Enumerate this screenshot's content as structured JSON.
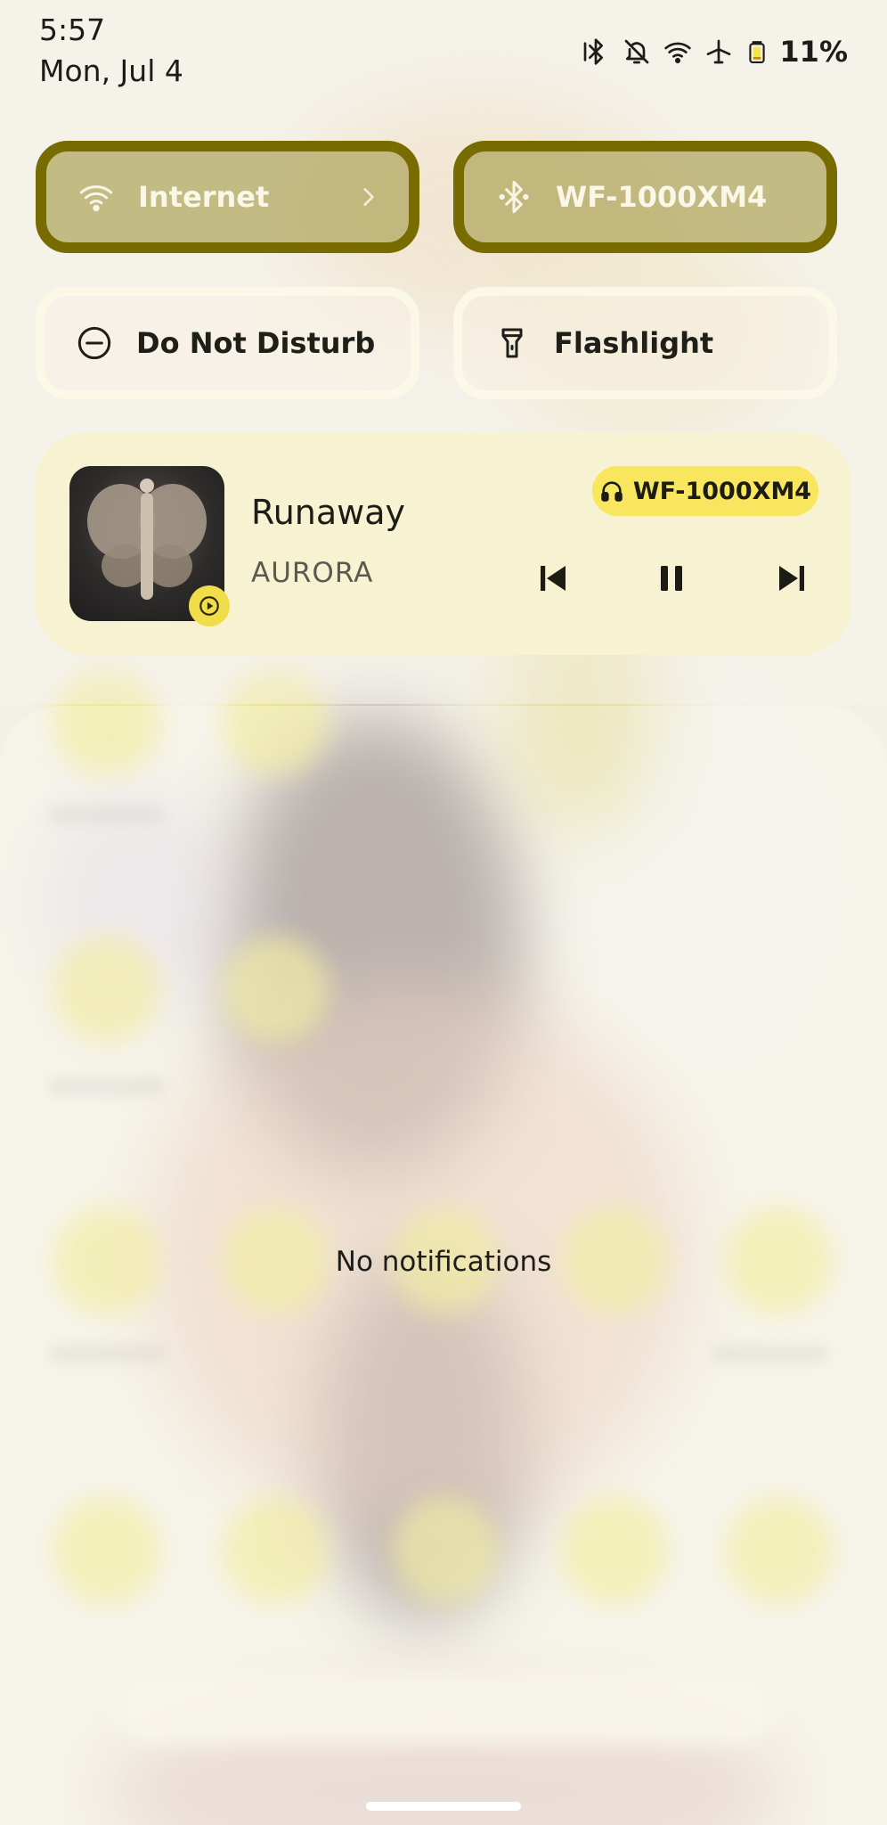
{
  "status_bar": {
    "time": "5:57",
    "date": "Mon, Jul 4",
    "icons": [
      "bluetooth-icon",
      "bell-off-icon",
      "wifi-icon",
      "airplane-icon",
      "battery-icon"
    ],
    "battery": "11%"
  },
  "tiles": [
    {
      "label": "Internet",
      "icon": "wifi-icon",
      "state": "on",
      "has_chevron": true
    },
    {
      "label": "WF-1000XM4",
      "icon": "bluetooth-icon",
      "state": "on"
    },
    {
      "label": "Do Not Disturb",
      "icon": "dnd-icon",
      "state": "off"
    },
    {
      "label": "Flashlight",
      "icon": "flashlight-icon",
      "state": "off"
    }
  ],
  "media": {
    "title": "Runaway",
    "artist": "AURORA",
    "output_device": "WF-1000XM4",
    "output_icon": "headphones-icon",
    "app_icon": "play-circle-icon",
    "controls": [
      "skip-previous-icon",
      "pause-icon",
      "skip-next-icon"
    ]
  },
  "notifications": {
    "empty_text": "No notifications"
  },
  "colors": {
    "active_tile_border": "#786c00",
    "media_background": "#f7f3d2",
    "chip_background": "#f7e65e",
    "badge": "#f1dd4a"
  }
}
